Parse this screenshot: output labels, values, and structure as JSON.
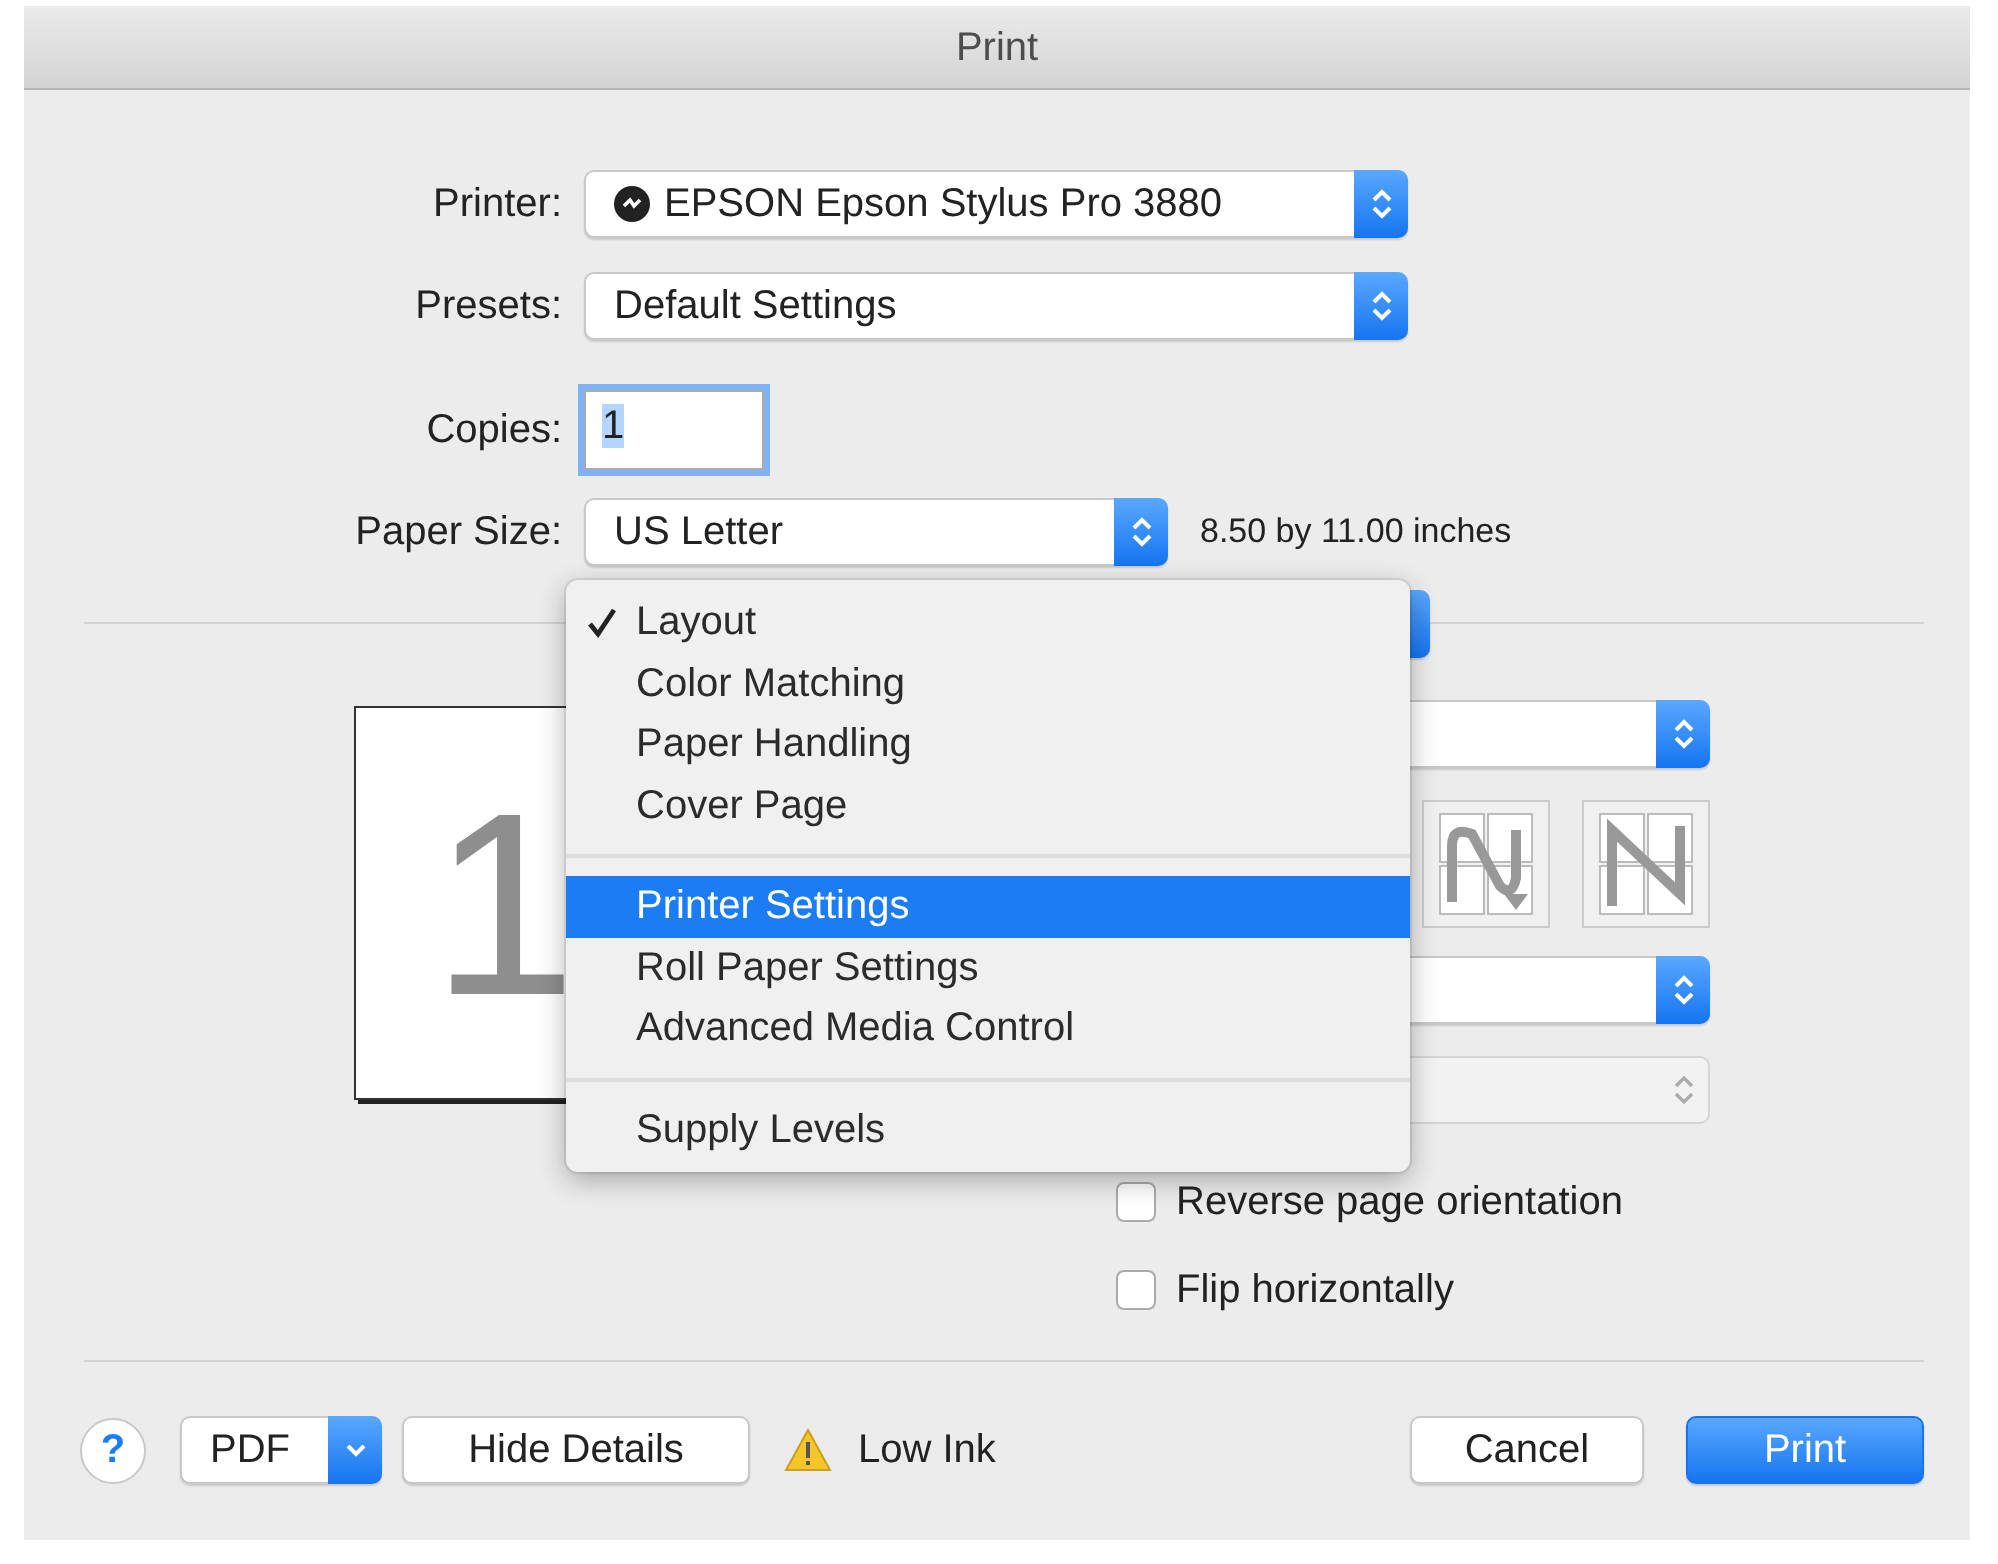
{
  "window": {
    "title": "Print"
  },
  "printer": {
    "label": "Printer:",
    "value": "EPSON Epson Stylus Pro 3880"
  },
  "presets": {
    "label": "Presets:",
    "value": "Default Settings"
  },
  "copies": {
    "label": "Copies:",
    "value": "1",
    "focused": true
  },
  "paper_size": {
    "label": "Paper Size:",
    "value": "US Letter",
    "dimensions": "8.50 by 11.00 inches"
  },
  "preview": {
    "page_number": "1"
  },
  "panel_menu": {
    "items": [
      {
        "kind": "item",
        "label": "Layout",
        "checked": true,
        "selected": false
      },
      {
        "kind": "item",
        "label": "Color Matching",
        "checked": false,
        "selected": false
      },
      {
        "kind": "item",
        "label": "Paper Handling",
        "checked": false,
        "selected": false
      },
      {
        "kind": "item",
        "label": "Cover Page",
        "checked": false,
        "selected": false
      },
      {
        "kind": "separator"
      },
      {
        "kind": "item",
        "label": "Printer Settings",
        "checked": false,
        "selected": true
      },
      {
        "kind": "item",
        "label": "Roll Paper Settings",
        "checked": false,
        "selected": false
      },
      {
        "kind": "item",
        "label": "Advanced Media Control",
        "checked": false,
        "selected": false
      },
      {
        "kind": "separator"
      },
      {
        "kind": "item",
        "label": "Supply Levels",
        "checked": false,
        "selected": false
      }
    ]
  },
  "layout_options": {
    "popups": [
      {
        "disabled": false
      },
      {
        "disabled": false
      },
      {
        "disabled": true
      }
    ],
    "checkboxes": [
      {
        "label": "Reverse page orientation",
        "checked": false
      },
      {
        "label": "Flip horizontally",
        "checked": false
      }
    ]
  },
  "footer": {
    "help": "?",
    "pdf": "PDF",
    "hide_details": "Hide Details",
    "status": "Low Ink",
    "cancel": "Cancel",
    "print": "Print"
  }
}
